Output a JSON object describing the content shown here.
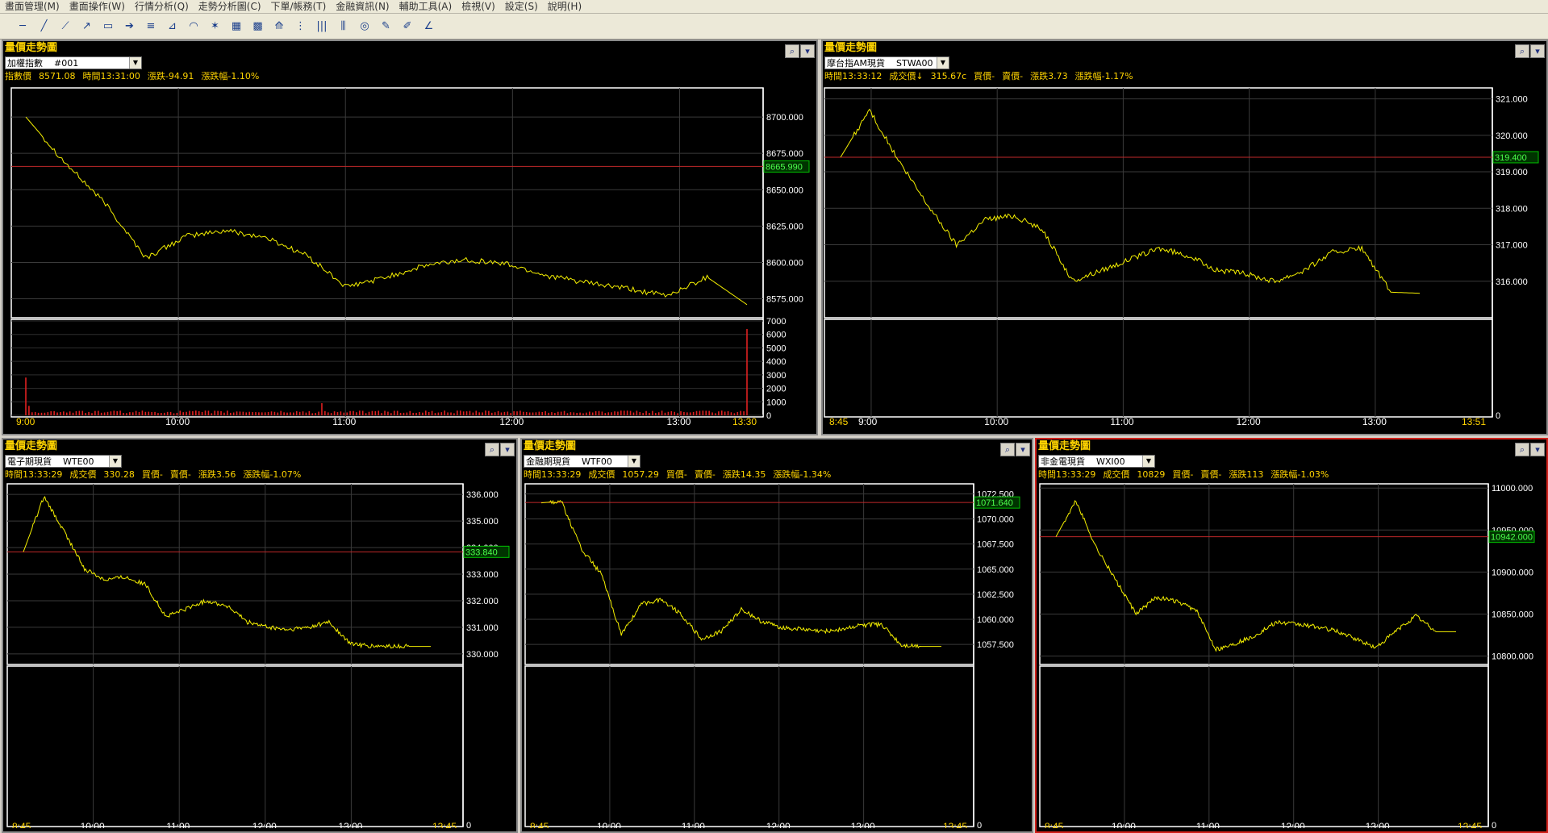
{
  "menu": [
    "畫面管理(M)",
    "畫面操作(W)",
    "行情分析(Q)",
    "走勢分析圖(C)",
    "下單/帳務(T)",
    "金融資訊(N)",
    "輔助工具(A)",
    "檢視(V)",
    "設定(S)",
    "說明(H)"
  ],
  "toolbar_icons": [
    "horizontal-line",
    "trend-line",
    "parallel-line",
    "ray-line",
    "rectangle",
    "arrow",
    "fibonacci-retracement",
    "fibonacci-fan",
    "fibonacci-arc",
    "gann-fan",
    "gann-box",
    "gann-grid",
    "speed-lines",
    "cycle-lines",
    "time-zones",
    "period-lines",
    "circle",
    "pencil",
    "text-pen",
    "angle"
  ],
  "panels": [
    {
      "title": "量價走勢圖",
      "symbol": "加權指數",
      "code": "#001",
      "info": [
        "指數價",
        "8571.08",
        "時間13:31:00",
        "漲跌-94.91",
        "漲跌幅-1.10%"
      ],
      "price_label": "8665.990",
      "x_start_label": "9:00",
      "x_ticks": [
        "10:00",
        "11:00",
        "12:00",
        "13:00"
      ],
      "x_end_label": "13:30",
      "y_ticks": [
        "8700.000",
        "8675.000",
        "8650.000",
        "8625.000",
        "8600.000",
        "8575.000"
      ],
      "vol_ticks": [
        "7000",
        "6000",
        "5000",
        "4000",
        "3000",
        "2000",
        "1000",
        "0"
      ],
      "has_volume": true,
      "active": false
    },
    {
      "title": "量價走勢圖",
      "symbol": "摩台指AM現貨",
      "code": "STWA00",
      "info": [
        "時間13:33:12",
        "成交價↓",
        "315.67c",
        "買價-",
        "賣價-",
        "漲跌3.73",
        "漲跌幅-1.17%"
      ],
      "price_label": "319.400",
      "x_start_label": "8:45",
      "x_ticks": [
        "9:00",
        "10:00",
        "11:00",
        "12:00",
        "13:00"
      ],
      "x_end_label": "13:51",
      "y_ticks": [
        "321.000",
        "320.000",
        "319.000",
        "318.000",
        "317.000",
        "316.000"
      ],
      "vol_ticks": [
        "0"
      ],
      "has_volume": false,
      "active": false
    },
    {
      "title": "量價走勢圖",
      "symbol": "電子期現貨",
      "code": "WTE00",
      "info": [
        "時間13:33:29",
        "成交價",
        "330.28",
        "買價-",
        "賣價-",
        "漲跌3.56",
        "漲跌幅-1.07%"
      ],
      "price_label": "333.840",
      "x_start_label": "8:45",
      "x_ticks": [
        "10:00",
        "11:00",
        "12:00",
        "13:00"
      ],
      "x_end_label": "13:45",
      "y_ticks": [
        "336.000",
        "335.000",
        "334.000",
        "333.000",
        "332.000",
        "331.000",
        "330.000"
      ],
      "vol_ticks": [
        "0"
      ],
      "has_volume": false,
      "active": false
    },
    {
      "title": "量價走勢圖",
      "symbol": "金融期現貨",
      "code": "WTF00",
      "info": [
        "時間13:33:29",
        "成交價",
        "1057.29",
        "買價-",
        "賣價-",
        "漲跌14.35",
        "漲跌幅-1.34%"
      ],
      "price_label": "1071.640",
      "x_start_label": "8:45",
      "x_ticks": [
        "10:00",
        "11:00",
        "12:00",
        "13:00"
      ],
      "x_end_label": "13:45",
      "y_ticks": [
        "1072.500",
        "1070.000",
        "1067.500",
        "1065.000",
        "1062.500",
        "1060.000",
        "1057.500"
      ],
      "vol_ticks": [
        "0"
      ],
      "has_volume": false,
      "active": false
    },
    {
      "title": "量價走勢圖",
      "symbol": "非金電現貨",
      "code": "WXI00",
      "info": [
        "時間13:33:29",
        "成交價",
        "10829",
        "買價-",
        "賣價-",
        "漲跌113",
        "漲跌幅-1.03%"
      ],
      "price_label": "10942.000",
      "x_start_label": "8:45",
      "x_ticks": [
        "10:00",
        "11:00",
        "12:00",
        "13:00"
      ],
      "x_end_label": "13:45",
      "y_ticks": [
        "11000.000",
        "10950.000",
        "10900.000",
        "10850.000",
        "10800.000"
      ],
      "vol_ticks": [
        "0"
      ],
      "has_volume": false,
      "active": true
    }
  ],
  "chart_data": [
    {
      "type": "line",
      "title": "量價走勢圖",
      "series": [
        {
          "name": "加權指數",
          "x": [
            "9:00",
            "9:15",
            "9:30",
            "9:45",
            "10:00",
            "10:15",
            "10:30",
            "10:45",
            "11:00",
            "11:15",
            "11:30",
            "11:45",
            "12:00",
            "12:15",
            "12:30",
            "12:45",
            "13:00",
            "13:15",
            "13:30"
          ],
          "values": [
            8700,
            8668,
            8640,
            8603,
            8618,
            8622,
            8617,
            8605,
            8583,
            8590,
            8598,
            8602,
            8599,
            8591,
            8586,
            8582,
            8577,
            8590,
            8571
          ]
        }
      ],
      "ylim": [
        8562,
        8720
      ],
      "reference": 8665.99,
      "volume": {
        "x": [
          "9:00",
          "11:00",
          "13:30"
        ],
        "values": [
          2800,
          900,
          6400
        ],
        "ylim": [
          0,
          7000
        ]
      }
    },
    {
      "type": "line",
      "title": "量價走勢圖",
      "series": [
        {
          "name": "摩台指AM現貨",
          "x": [
            "8:45",
            "9:00",
            "9:15",
            "9:30",
            "9:45",
            "10:00",
            "10:15",
            "10:30",
            "10:45",
            "11:00",
            "11:15",
            "11:30",
            "11:45",
            "12:00",
            "12:15",
            "12:30",
            "12:45",
            "13:00",
            "13:15",
            "13:30",
            "13:45"
          ],
          "values": [
            319.4,
            320.7,
            319.3,
            318.1,
            317.0,
            317.7,
            317.8,
            317.4,
            316.0,
            316.3,
            316.6,
            316.9,
            316.7,
            316.3,
            316.2,
            316.0,
            316.3,
            316.8,
            316.9,
            315.7,
            315.67
          ]
        }
      ],
      "ylim": [
        315.0,
        321.3
      ],
      "reference": 319.4
    },
    {
      "type": "line",
      "title": "量價走勢圖",
      "series": [
        {
          "name": "電子期現貨",
          "x": [
            "8:45",
            "9:00",
            "9:15",
            "9:30",
            "9:45",
            "10:00",
            "10:15",
            "10:30",
            "10:45",
            "11:00",
            "11:15",
            "11:30",
            "11:45",
            "12:00",
            "12:15",
            "12:30",
            "12:45",
            "13:00",
            "13:15",
            "13:30",
            "13:45"
          ],
          "values": [
            333.84,
            335.9,
            334.6,
            333.2,
            332.8,
            332.9,
            332.6,
            331.4,
            331.7,
            332.0,
            331.8,
            331.2,
            331.0,
            330.9,
            331.0,
            331.2,
            330.4,
            330.28,
            330.28,
            330.28,
            330.28
          ]
        }
      ],
      "ylim": [
        329.6,
        336.4
      ],
      "reference": 333.84
    },
    {
      "type": "line",
      "title": "量價走勢圖",
      "series": [
        {
          "name": "金融期現貨",
          "x": [
            "8:45",
            "9:00",
            "9:15",
            "9:30",
            "9:45",
            "10:00",
            "10:15",
            "10:30",
            "10:45",
            "11:00",
            "11:15",
            "11:30",
            "11:45",
            "12:00",
            "12:15",
            "12:30",
            "12:45",
            "13:00",
            "13:15",
            "13:30",
            "13:45"
          ],
          "values": [
            1071.6,
            1071.8,
            1067.0,
            1064.5,
            1058.5,
            1061.5,
            1062.0,
            1060.5,
            1058.0,
            1058.8,
            1061.0,
            1059.8,
            1059.2,
            1059.0,
            1058.8,
            1059.0,
            1059.4,
            1059.5,
            1057.4,
            1057.3,
            1057.3
          ]
        }
      ],
      "ylim": [
        1055.5,
        1073.5
      ],
      "reference": 1071.64
    },
    {
      "type": "line",
      "title": "量價走勢圖",
      "series": [
        {
          "name": "非金電現貨",
          "x": [
            "8:45",
            "9:00",
            "9:15",
            "9:30",
            "9:45",
            "10:00",
            "10:15",
            "10:30",
            "10:45",
            "11:00",
            "11:15",
            "11:30",
            "11:45",
            "12:00",
            "12:15",
            "12:30",
            "12:45",
            "13:00",
            "13:15",
            "13:30",
            "13:45"
          ],
          "values": [
            10942,
            10985,
            10930,
            10890,
            10850,
            10870,
            10865,
            10855,
            10808,
            10815,
            10825,
            10840,
            10838,
            10835,
            10830,
            10820,
            10810,
            10830,
            10848,
            10829,
            10829
          ]
        }
      ],
      "ylim": [
        10790,
        11005
      ],
      "reference": 10942
    }
  ]
}
